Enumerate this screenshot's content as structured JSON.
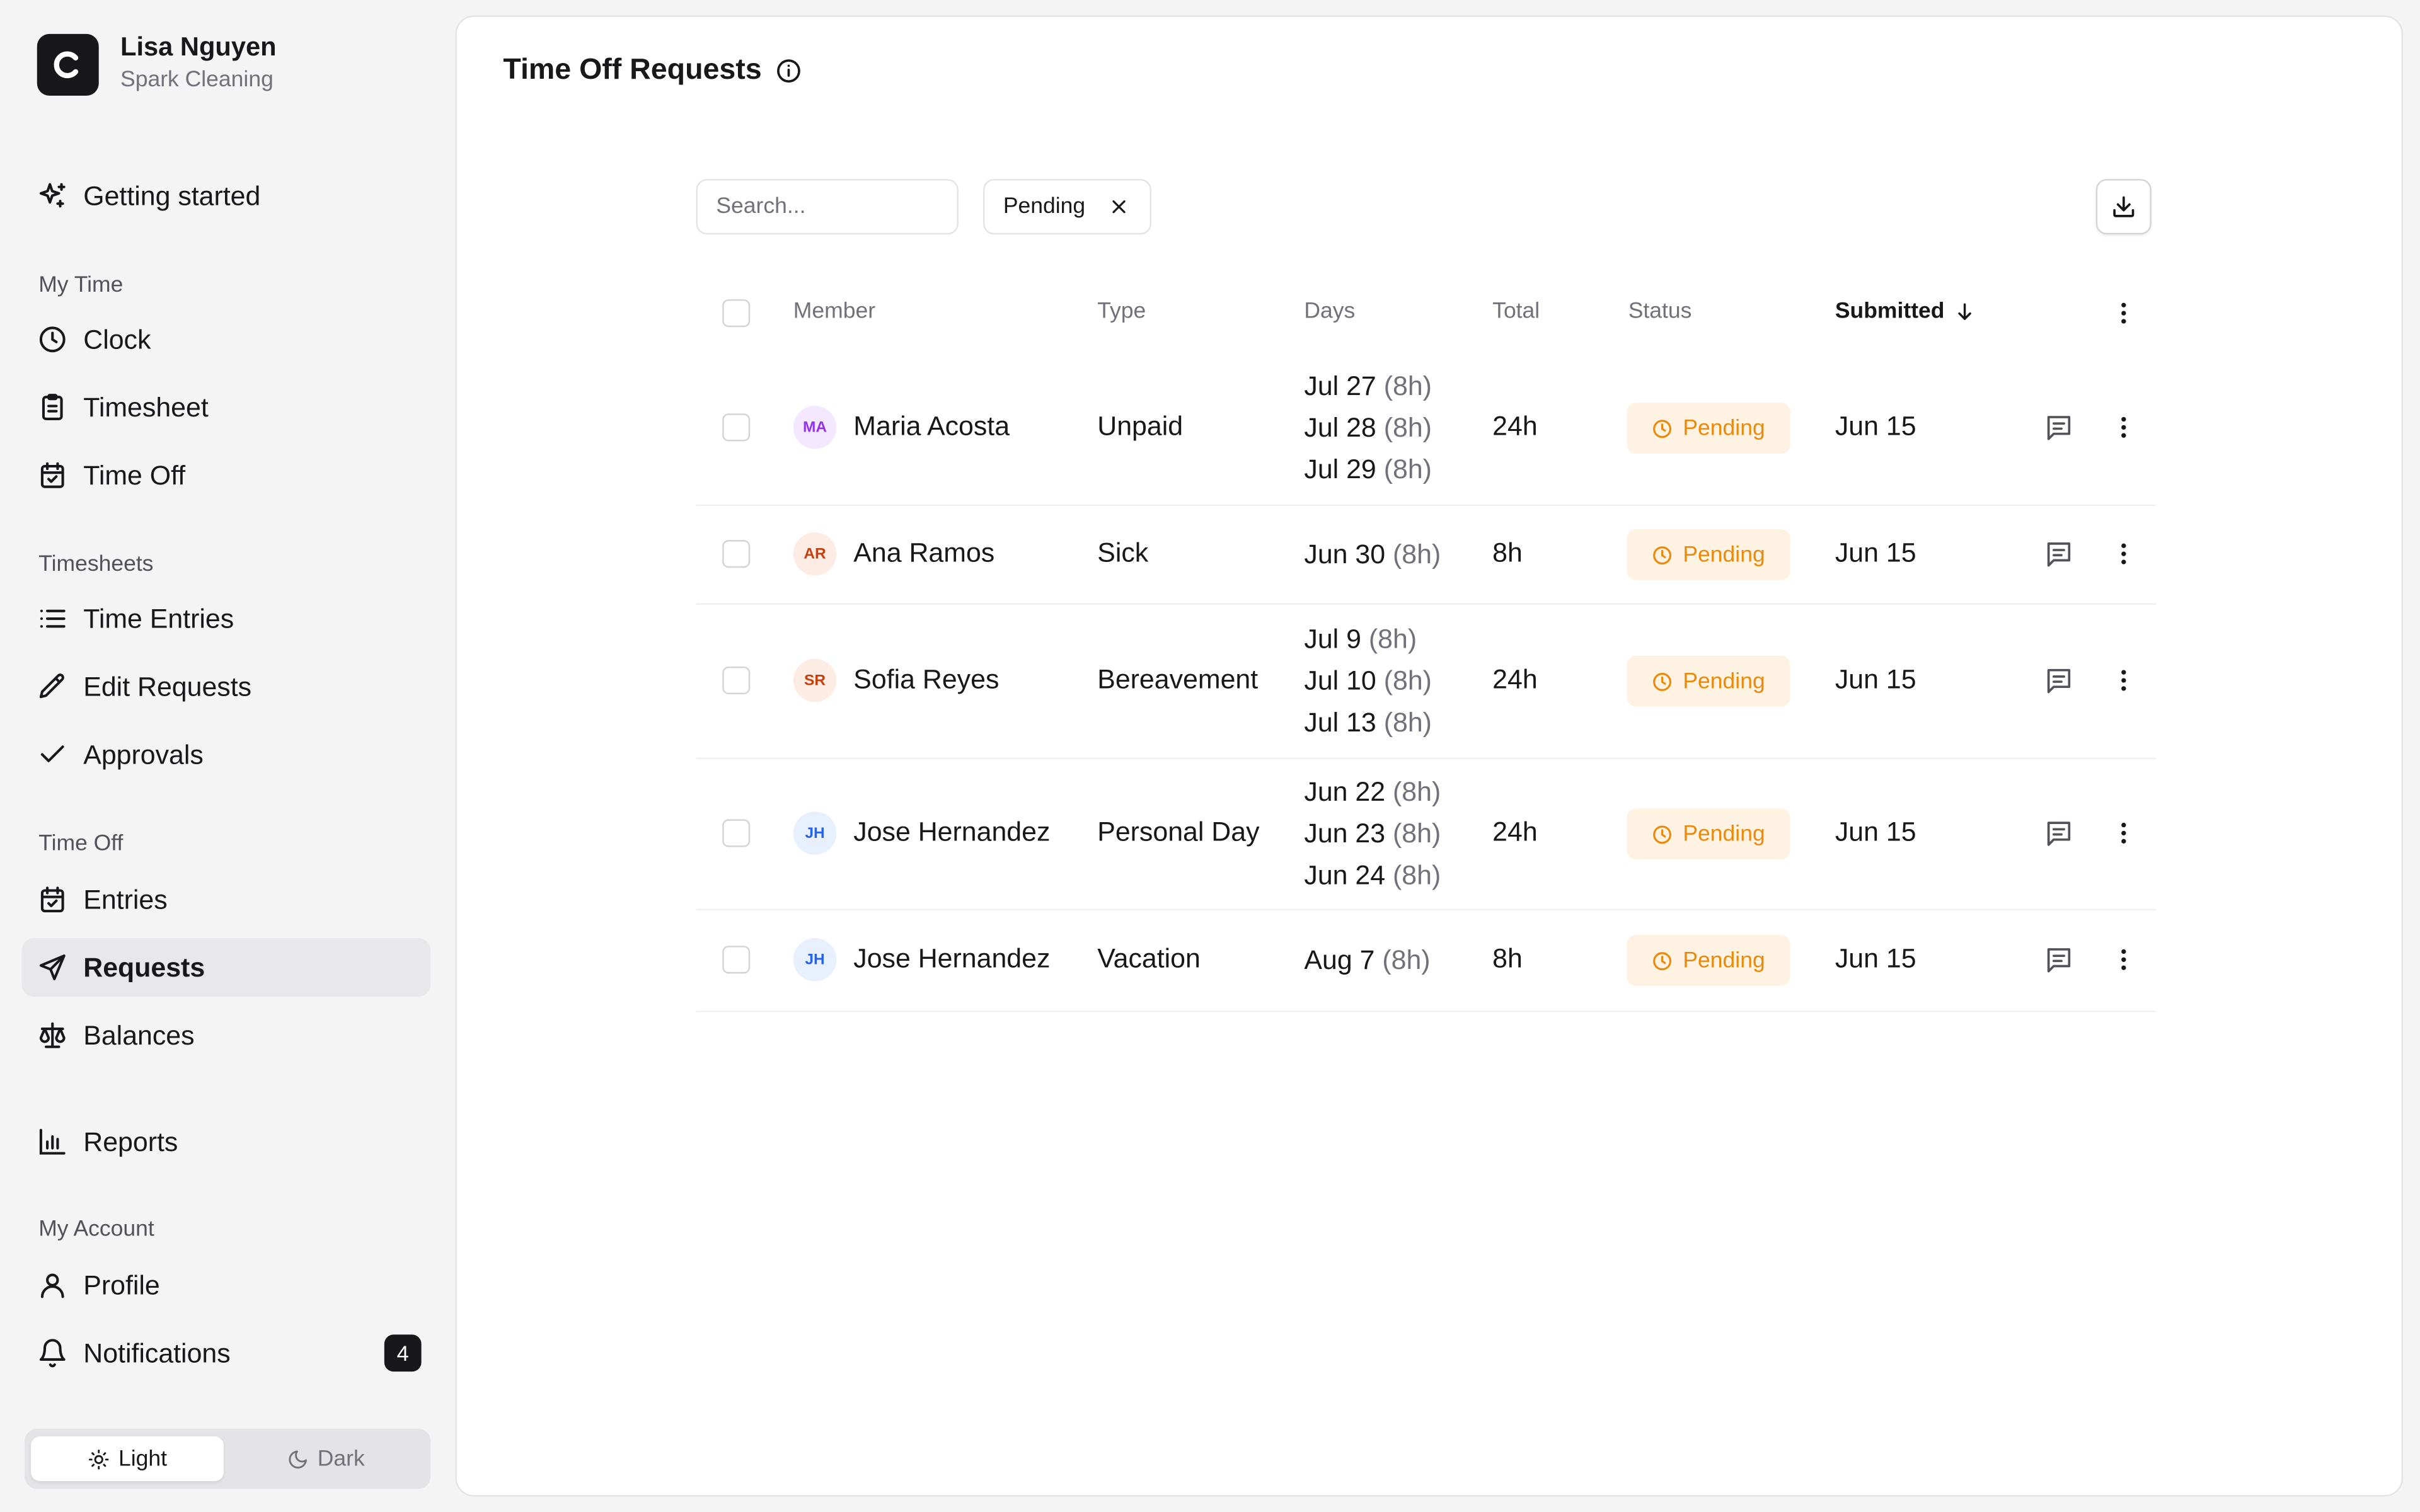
{
  "user": {
    "name": "Lisa Nguyen",
    "org": "Spark Cleaning",
    "logo_letter": "C"
  },
  "sidebar": {
    "getting_started": "Getting started",
    "sections": {
      "my_time": "My Time",
      "timesheets": "Timesheets",
      "time_off": "Time Off",
      "my_account": "My Account"
    },
    "items": {
      "clock": "Clock",
      "timesheet": "Timesheet",
      "time_off": "Time Off",
      "time_entries": "Time Entries",
      "edit_requests": "Edit Requests",
      "approvals": "Approvals",
      "entries": "Entries",
      "requests": "Requests",
      "balances": "Balances",
      "reports": "Reports",
      "profile": "Profile",
      "notifications": "Notifications"
    },
    "notifications_count": "4",
    "active_item": "requests",
    "theme": {
      "light": "Light",
      "dark": "Dark",
      "selected": "Light"
    }
  },
  "page": {
    "title": "Time Off Requests",
    "search_placeholder": "Search...",
    "filter_chip": "Pending"
  },
  "table": {
    "columns": {
      "member": "Member",
      "type": "Type",
      "days": "Days",
      "total": "Total",
      "status": "Status",
      "submitted": "Submitted"
    },
    "sort": {
      "column": "submitted",
      "direction": "descending"
    },
    "rows": [
      {
        "initials": "MA",
        "avatar_bg": "#f3e8ff",
        "avatar_fg": "#9333ea",
        "member": "Maria Acosta",
        "type": "Unpaid",
        "days": [
          {
            "date": "Jul 27",
            "hours": "(8h)"
          },
          {
            "date": "Jul 28",
            "hours": "(8h)"
          },
          {
            "date": "Jul 29",
            "hours": "(8h)"
          }
        ],
        "total": "24h",
        "status": "Pending",
        "submitted": "Jun 15"
      },
      {
        "initials": "AR",
        "avatar_bg": "#fdece4",
        "avatar_fg": "#c2410c",
        "member": "Ana Ramos",
        "type": "Sick",
        "days": [
          {
            "date": "Jun 30",
            "hours": "(8h)"
          }
        ],
        "total": "8h",
        "status": "Pending",
        "submitted": "Jun 15"
      },
      {
        "initials": "SR",
        "avatar_bg": "#fdece4",
        "avatar_fg": "#c2410c",
        "member": "Sofia Reyes",
        "type": "Bereavement",
        "days": [
          {
            "date": "Jul 9",
            "hours": "(8h)"
          },
          {
            "date": "Jul 10",
            "hours": "(8h)"
          },
          {
            "date": "Jul 13",
            "hours": "(8h)"
          }
        ],
        "total": "24h",
        "status": "Pending",
        "submitted": "Jun 15"
      },
      {
        "initials": "JH",
        "avatar_bg": "#e8f0fd",
        "avatar_fg": "#2563eb",
        "member": "Jose Hernandez",
        "type": "Personal Day",
        "days": [
          {
            "date": "Jun 22",
            "hours": "(8h)"
          },
          {
            "date": "Jun 23",
            "hours": "(8h)"
          },
          {
            "date": "Jun 24",
            "hours": "(8h)"
          }
        ],
        "total": "24h",
        "status": "Pending",
        "submitted": "Jun 15"
      },
      {
        "initials": "JH",
        "avatar_bg": "#e8f0fd",
        "avatar_fg": "#2563eb",
        "member": "Jose Hernandez",
        "type": "Vacation",
        "days": [
          {
            "date": "Aug 7",
            "hours": "(8h)"
          }
        ],
        "total": "8h",
        "status": "Pending",
        "submitted": "Jun 15"
      }
    ]
  },
  "colors": {
    "accent": "#18181b",
    "pending_bg": "#fef3e2",
    "pending_fg": "#ea8a0c"
  },
  "icons": {
    "logo": "c-logo-icon",
    "getting_started": "sparkles-icon",
    "clock": "clock-icon",
    "timesheet": "clipboard-icon",
    "time_off": "calendar-check-icon",
    "time_entries": "list-icon",
    "edit_requests": "pencil-icon",
    "approvals": "check-icon",
    "entries": "calendar-check-icon",
    "requests": "send-icon",
    "balances": "scale-icon",
    "reports": "bar-chart-icon",
    "profile": "user-icon",
    "notifications": "bell-icon",
    "info": "info-icon",
    "download": "download-icon",
    "comment": "message-square-icon",
    "more": "more-vertical-icon"
  }
}
